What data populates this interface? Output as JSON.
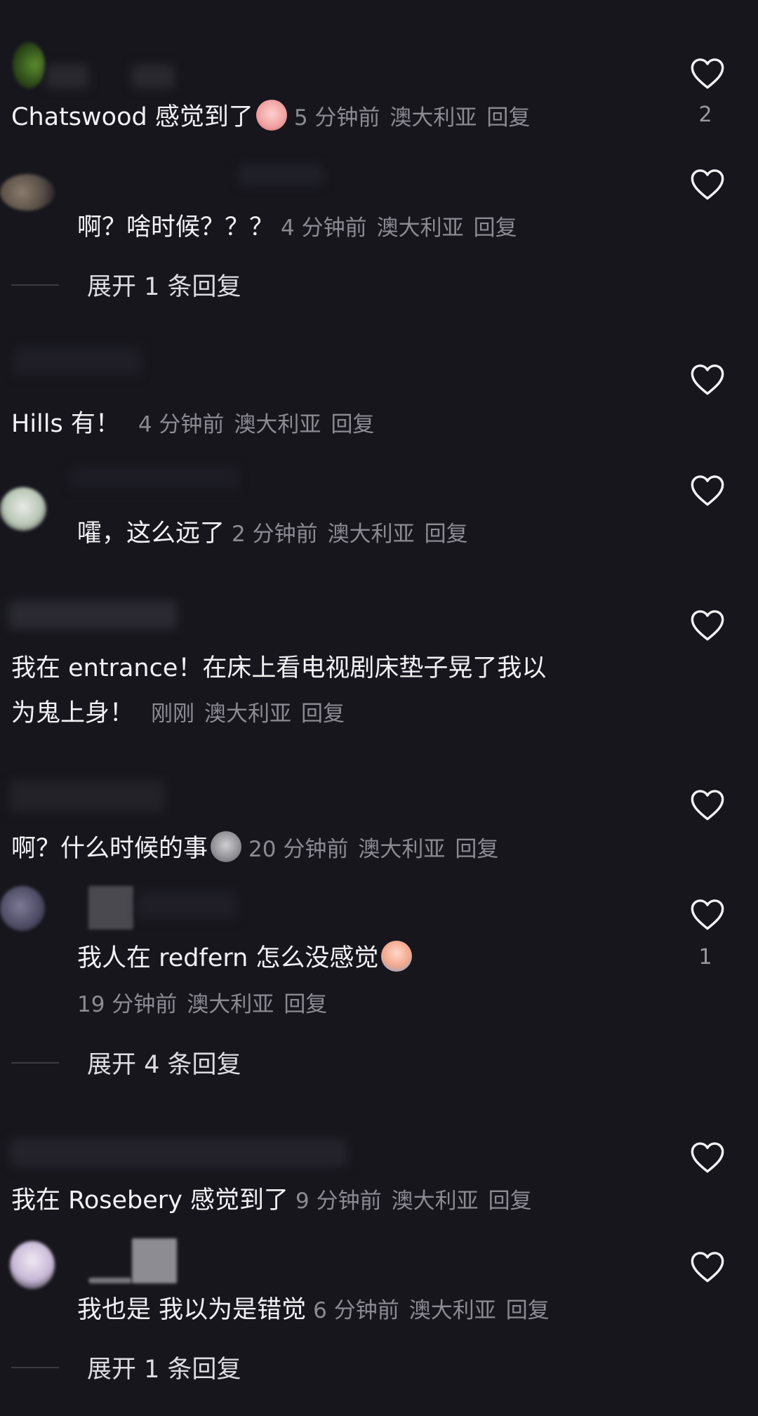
{
  "comments": [
    {
      "text": "Chatswood 感觉到了",
      "emoji": "weary-face-emoji",
      "time": "5 分钟前",
      "region": "澳大利亚",
      "reply": "回复",
      "likes": "2"
    },
    {
      "text": "啊？啥时候？？？",
      "time": "4 分钟前",
      "region": "澳大利亚",
      "reply": "回复",
      "expand": "展开 1 条回复"
    },
    {
      "text": "Hills 有！",
      "time": "4 分钟前",
      "region": "澳大利亚",
      "reply": "回复"
    },
    {
      "text": "嚯，这么远了",
      "time": "2 分钟前",
      "region": "澳大利亚",
      "reply": "回复"
    },
    {
      "text_line1": "我在 entrance！在床上看电视剧床垫子晃了我以",
      "text_line2": "为鬼上身！",
      "time": "刚刚",
      "region": "澳大利亚",
      "reply": "回复"
    },
    {
      "text": "啊？什么时候的事",
      "emoji": "shocked-face-emoji",
      "time": "20 分钟前",
      "region": "澳大利亚",
      "reply": "回复"
    },
    {
      "text": "我人在 redfern 怎么没感觉",
      "emoji": "crying-face-emoji",
      "time": "19 分钟前",
      "region": "澳大利亚",
      "reply": "回复",
      "likes": "1",
      "expand": "展开 4 条回复"
    },
    {
      "text": "我在 Rosebery 感觉到了",
      "time": "9 分钟前",
      "region": "澳大利亚",
      "reply": "回复"
    },
    {
      "text": "我也是 我以为是错觉",
      "time": "6 分钟前",
      "region": "澳大利亚",
      "reply": "回复",
      "expand": "展开 1 条回复"
    }
  ]
}
